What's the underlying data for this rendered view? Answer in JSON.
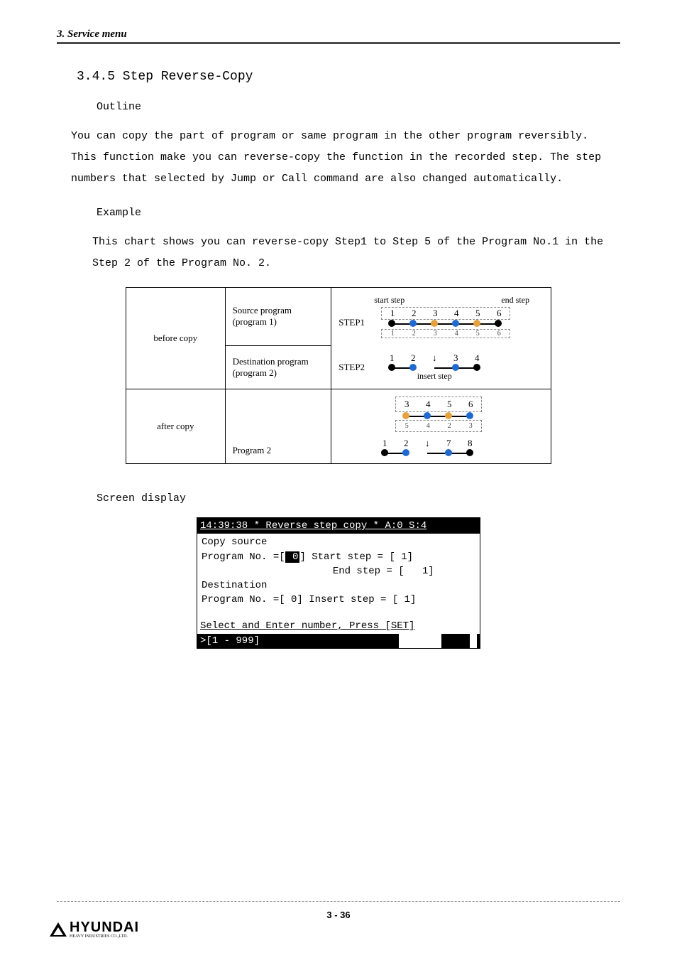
{
  "header": {
    "title": "3. Service menu"
  },
  "section": {
    "heading": "3.4.5 Step Reverse-Copy"
  },
  "outline": {
    "label": "Outline",
    "text": "You can copy the part of program or same program in the other program reversibly. This function make you can reverse-copy the function in the recorded step. The step numbers that selected by Jump or Call command are also changed automatically."
  },
  "example": {
    "label": "Example",
    "text": "This chart shows you can reverse-copy Step1 to Step 5 of the Program No.1 in the Step 2 of the Program No. 2."
  },
  "diagram": {
    "before_label": "before copy",
    "after_label": "after copy",
    "src_prog": "Source program\n(program 1)",
    "dst_prog": "Destination program\n(program 2)",
    "prog2": "Program 2",
    "step1": "STEP1",
    "step2": "STEP2",
    "start_step": "start step",
    "end_step": "end step",
    "insert_step": "insert step",
    "s1_nums": [
      "1",
      "2",
      "3",
      "4",
      "5",
      "6"
    ],
    "s1_idx": [
      "1",
      "2",
      "3",
      "4",
      "5",
      "6"
    ],
    "s2_nums": [
      "1",
      "2",
      "3",
      "4"
    ],
    "after_top_nums": [
      "3",
      "4",
      "5",
      "6"
    ],
    "after_top_idx": [
      "5",
      "4",
      "2",
      "3"
    ],
    "after_bot_nums": [
      "1",
      "2",
      "7",
      "8"
    ]
  },
  "screen": {
    "label": "Screen display",
    "title": "14:39:38 * Reverse step copy * A:0 S:4",
    "l1": "Copy source",
    "l2a": "Program No. =[",
    "l2b": "  0",
    "l2c": "]   Start step = [   1]",
    "l3": "                      End step = [   1]",
    "l4": "Destination",
    "l5": "Program No. =[   0] Insert step = [   1]",
    "prompt": "Select and Enter number, Press [SET]",
    "range": ">[1 - 999]"
  },
  "footer": {
    "page": "3 - 36",
    "brand": "HYUNDAI",
    "brand_sub": "HEAVY INDUSTRIES CO.,LTD."
  }
}
